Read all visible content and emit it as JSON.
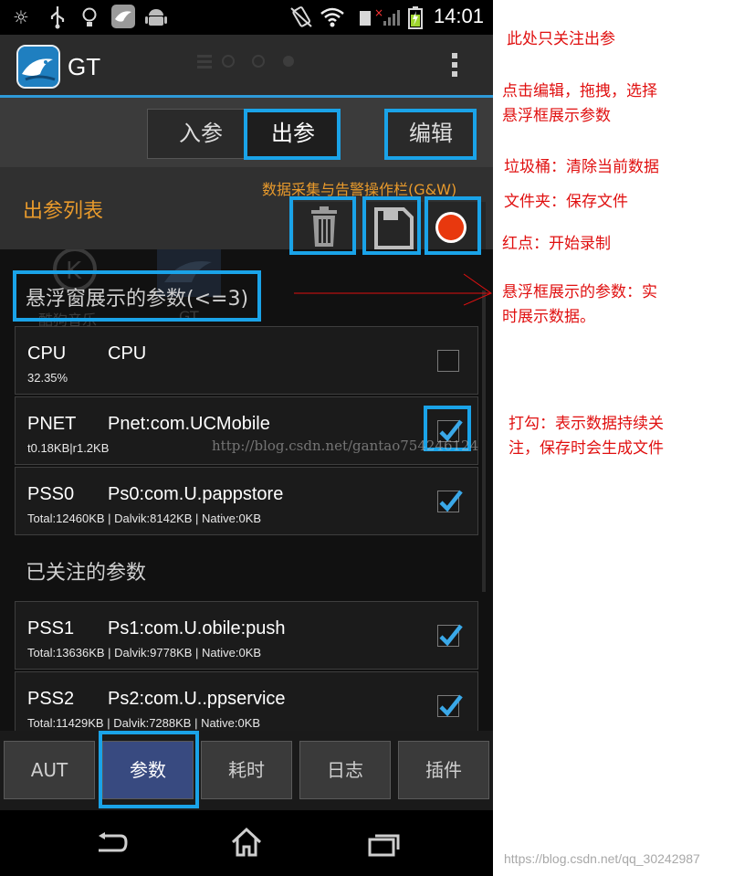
{
  "status_bar": {
    "time": "14:01",
    "icons": [
      "brightness-icon",
      "usb-icon",
      "bulb-icon",
      "gt-app-icon",
      "android-icon",
      "vibrate-icon",
      "wifi-icon",
      "sim-no-signal-icon",
      "battery-charging-icon"
    ]
  },
  "action_bar": {
    "title": "GT",
    "logo": "gt-bird-logo",
    "overflow_icon": "overflow-menu-icon"
  },
  "top_tabs": {
    "in_params": "入参",
    "out_params": "出参",
    "edit": "编辑",
    "selected": "出参"
  },
  "title_row": {
    "list_title": "出参列表",
    "gw_label": "数据采集与告警操作栏(G&W)",
    "tools": [
      "trash-icon",
      "save-icon",
      "record-icon"
    ]
  },
  "background_ghost": {
    "app1": "酷狗音乐",
    "app2": "GT"
  },
  "floating_section": {
    "title": "悬浮窗展示的参数(<=3)",
    "rows": [
      {
        "key": "CPU",
        "alias": "CPU",
        "value": "32.35%",
        "checked": false
      },
      {
        "key": "PNET",
        "alias": "Pnet:com.UCMobile",
        "value": "t0.18KB|r1.2KB",
        "checked": true
      },
      {
        "key": "PSS0",
        "alias": "Ps0:com.U.pappstore",
        "value": "Total:12460KB | Dalvik:8142KB | Native:0KB",
        "checked": true
      }
    ]
  },
  "watched_section": {
    "title": "已关注的参数",
    "rows": [
      {
        "key": "PSS1",
        "alias": "Ps1:com.U.obile:push",
        "value": "Total:13636KB | Dalvik:9778KB | Native:0KB",
        "checked": true
      },
      {
        "key": "PSS2",
        "alias": "Ps2:com.U..ppservice",
        "value": "Total:11429KB | Dalvik:7288KB | Native:0KB",
        "checked": true
      }
    ]
  },
  "bottom_tabs": [
    {
      "label": "AUT"
    },
    {
      "label": "参数"
    },
    {
      "label": "耗时"
    },
    {
      "label": "日志"
    },
    {
      "label": "插件"
    }
  ],
  "bottom_tabs_selected": "参数",
  "nav_bar": {
    "icons": [
      "back-icon",
      "home-icon",
      "recents-icon"
    ]
  },
  "annotations": {
    "n1": "此处只关注出参",
    "n2a": "点击编辑，拖拽，选择",
    "n2b": "悬浮框展示参数",
    "n3": "垃圾桶：清除当前数据",
    "n4": "文件夹：保存文件",
    "n5": "红点：开始录制",
    "n6a": "悬浮框展示的参数：实",
    "n6b": "时展示数据。",
    "n7a": "打勾：表示数据持续关",
    "n7b": "注，保存时会生成文件"
  },
  "watermark": "http://blog.csdn.net/gantao754246124",
  "footer_url": "https://blog.csdn.net/qq_30242987",
  "colors": {
    "accent_blue": "#2e9ad8",
    "highlight_cyan": "#1aa3e8",
    "orange": "#e89a2c",
    "note_red": "#e01010",
    "record_red": "#e8380e",
    "active_tab": "#384a80"
  }
}
